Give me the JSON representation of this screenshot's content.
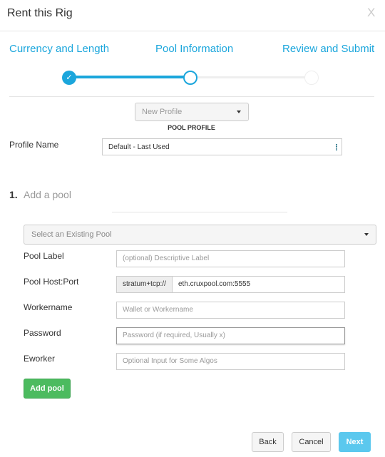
{
  "dialog": {
    "title": "Rent this Rig",
    "close_label": "X"
  },
  "steps": [
    {
      "label": "Currency and Length",
      "state": "done"
    },
    {
      "label": "Pool Information",
      "state": "active"
    },
    {
      "label": "Review and Submit",
      "state": "pending"
    }
  ],
  "colors": {
    "accent": "#1ba6dc",
    "success": "#4cbb5f",
    "next": "#5bc8ee"
  },
  "profile": {
    "dropdown_value": "New Profile",
    "section_label": "POOL PROFILE",
    "name_label": "Profile Name",
    "name_value": "Default - Last Used"
  },
  "pool": {
    "number": "1.",
    "heading": "Add a pool",
    "select_placeholder": "Select an Existing Pool",
    "fields": [
      {
        "label": "Pool Label",
        "placeholder": "(optional) Descriptive Label"
      },
      {
        "label": "Pool Host:Port",
        "prefix": "stratum+tcp://",
        "value": "eth.cruxpool.com:5555"
      },
      {
        "label": "Workername",
        "placeholder": "Wallet or Workername"
      },
      {
        "label": "Password",
        "placeholder": "Password (if required, Usually x)"
      },
      {
        "label": "Eworker",
        "placeholder": "Optional Input for Some Algos"
      }
    ],
    "add_button": "Add pool"
  },
  "footer": {
    "back": "Back",
    "cancel": "Cancel",
    "next": "Next"
  }
}
